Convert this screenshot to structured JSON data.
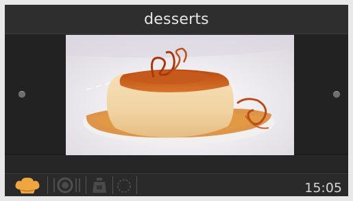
{
  "header": {
    "title": "desserts"
  },
  "content": {
    "image_alt": "flan-dessert-photo",
    "nav": {
      "prev_icon": "dot-icon",
      "next_icon": "dot-icon"
    }
  },
  "footer": {
    "tabs": [
      {
        "icon": "chef-hat-icon",
        "active": true
      },
      {
        "icon": "plate-cutlery-icon",
        "active": false
      },
      {
        "icon": "weight-icon",
        "active": false
      },
      {
        "icon": "timer-icon",
        "active": false
      }
    ],
    "clock": "15:05"
  },
  "colors": {
    "accent": "#f0a640",
    "background": "#1c1c1c",
    "header": "#2e2e2e",
    "text": "#e6e6e6"
  }
}
